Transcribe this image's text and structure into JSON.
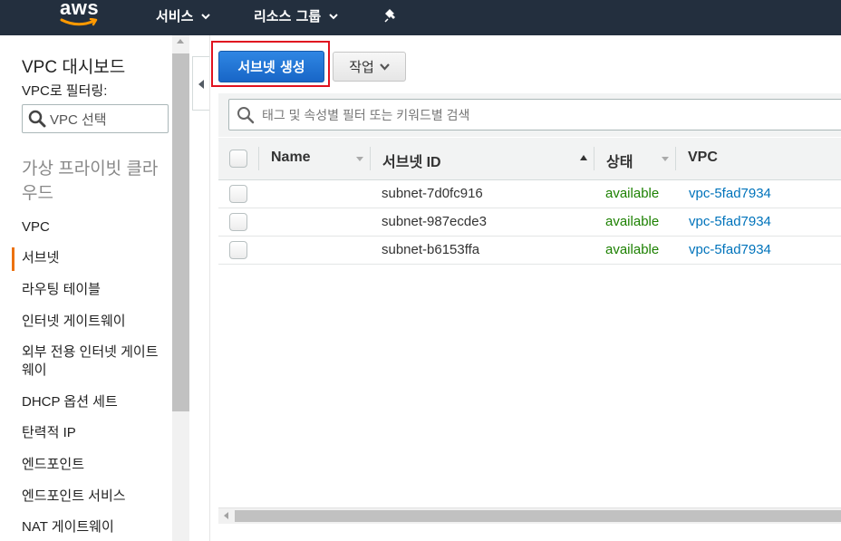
{
  "topnav": {
    "logo_text": "aws",
    "services_label": "서비스",
    "resource_groups_label": "리소스 그룹"
  },
  "sidebar": {
    "title": "VPC 대시보드",
    "filter_label": "VPC로 필터링:",
    "vpc_select_placeholder": "VPC 선택",
    "section_heading": "가상 프라이빗 클라우드",
    "items": [
      {
        "label": "VPC"
      },
      {
        "label": "서브넷"
      },
      {
        "label": "라우팅 테이블"
      },
      {
        "label": "인터넷 게이트웨이"
      },
      {
        "label": "외부 전용 인터넷 게이트웨이"
      },
      {
        "label": "DHCP 옵션 세트"
      },
      {
        "label": "탄력적 IP"
      },
      {
        "label": "엔드포인트"
      },
      {
        "label": "엔드포인트 서비스"
      },
      {
        "label": "NAT 게이트웨이"
      }
    ],
    "active_item": "서브넷"
  },
  "toolbar": {
    "create_subnet_label": "서브넷 생성",
    "actions_label": "작업"
  },
  "search": {
    "placeholder": "태그 및 속성별 필터 또는 키워드별 검색"
  },
  "table": {
    "columns": [
      "Name",
      "서브넷 ID",
      "상태",
      "VPC"
    ],
    "rows": [
      {
        "name": "",
        "subnet_id": "subnet-7d0fc916",
        "state": "available",
        "vpc": "vpc-5fad7934"
      },
      {
        "name": "",
        "subnet_id": "subnet-987ecde3",
        "state": "available",
        "vpc": "vpc-5fad7934"
      },
      {
        "name": "",
        "subnet_id": "subnet-b6153ffa",
        "state": "available",
        "vpc": "vpc-5fad7934"
      }
    ]
  },
  "colors": {
    "nav_bg": "#232f3e",
    "primary_button": "#1e72d6",
    "highlight_border": "#e0121f",
    "active_indicator": "#ec7211",
    "status_available": "#1d8102",
    "link": "#0073bb"
  },
  "icons": [
    "chevron-down-icon",
    "pin-icon",
    "search-icon",
    "collapse-left-icon",
    "caret-down-icon"
  ]
}
